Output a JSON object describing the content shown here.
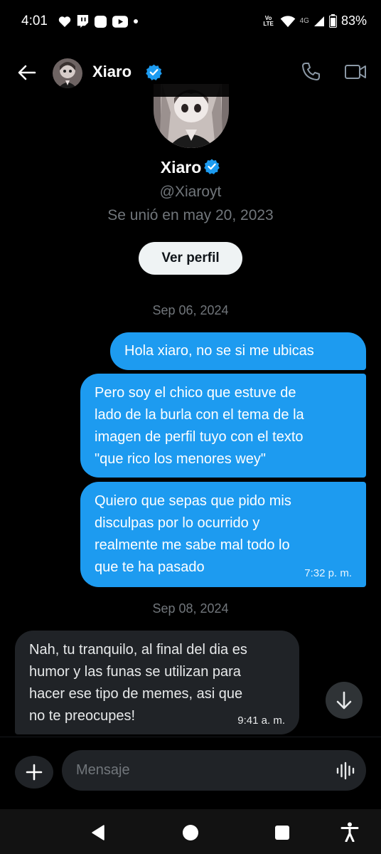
{
  "status_bar": {
    "time": "4:01",
    "notification_icons": [
      "heart-icon",
      "twitch-icon",
      "square-app-icon",
      "youtube-icon",
      "dot-icon"
    ],
    "volte": "Vo LTE",
    "network": "4G",
    "battery": "83%"
  },
  "header": {
    "name": "Xiaro",
    "verified": true,
    "accent_color": "#1d9bf0"
  },
  "profile": {
    "name": "Xiaro",
    "handle": "@Xiaroyt",
    "joined": "Se unió en may 20, 2023",
    "view_profile_label": "Ver perfil"
  },
  "conversation": {
    "date_1": "Sep 06, 2024",
    "sent_1": "Hola xiaro, no se si me ubicas",
    "sent_2": [
      "Pero soy el chico que estuve de",
      "lado de la burla con el tema de la",
      "imagen de perfil tuyo con el texto",
      "\"que rico los menores wey\""
    ],
    "sent_3": [
      "Quiero que sepas que pido mis",
      "disculpas por lo ocurrido y",
      "realmente me sabe mal todo lo",
      "que te ha pasado"
    ],
    "sent_3_time": "7:32 p. m.",
    "date_2": "Sep 08, 2024",
    "recv_1": [
      "Nah, tu tranquilo, al final del dia es",
      "humor y las funas se utilizan para",
      "hacer ese tipo de memes, asi que",
      "no te preocupes!"
    ],
    "recv_1_time": "9:41 a. m."
  },
  "composer": {
    "placeholder": "Mensaje"
  },
  "colors": {
    "sent_bubble": "#1d9bf0",
    "received_bubble": "#202327",
    "background": "#000000",
    "muted_text": "#71767b"
  }
}
